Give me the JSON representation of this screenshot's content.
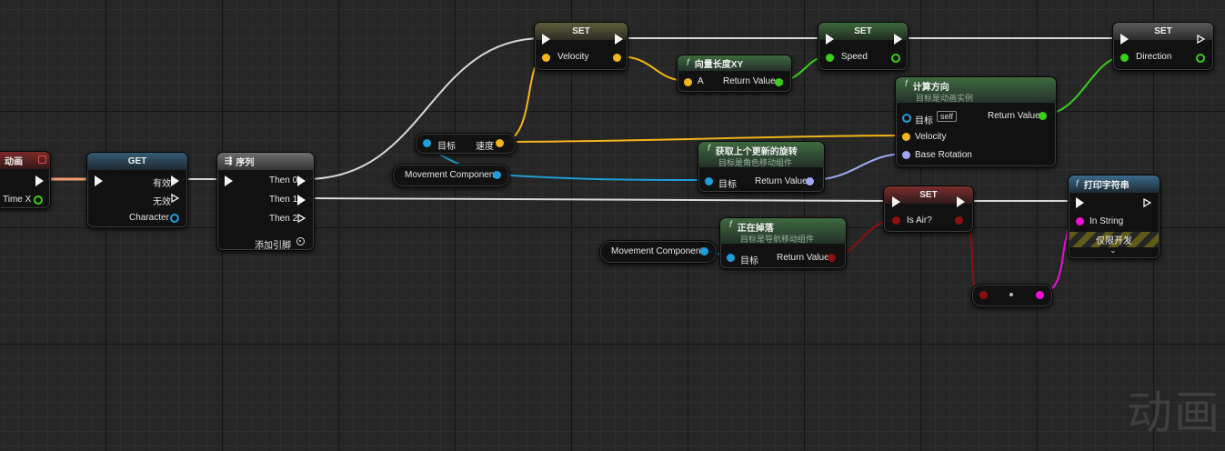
{
  "colors": {
    "exec": "#f2f2f2",
    "vector": "#f2b61c",
    "object": "#1f9ed8",
    "boolean": "#8d0f0f",
    "float": "#39d01a",
    "rotator": "#9fa8f2",
    "string": "#f10fd8",
    "orange": "#f0a070"
  },
  "nodes": {
    "anim_event": {
      "title": "动画",
      "pin": "Time X"
    },
    "get_node": {
      "title": "GET",
      "pin_valid": "有效",
      "pin_invalid": "无效",
      "pin_character": "Character"
    },
    "sequence": {
      "title": "序列",
      "then0": "Then 0",
      "then1": "Then 1",
      "then2": "Then 2",
      "add_pin": "添加引脚"
    },
    "set_velocity": {
      "title": "SET",
      "pin": "Velocity"
    },
    "set_speed": {
      "title": "SET",
      "pin": "Speed"
    },
    "set_direction": {
      "title": "SET",
      "pin": "Direction"
    },
    "vector_length": {
      "title": "向量长度XY",
      "pin_a": "A",
      "return": "Return Value"
    },
    "calc_direction": {
      "title": "计算方向",
      "subtitle": "目标是动画实例",
      "target": "目标",
      "self": "self",
      "return": "Return Value",
      "velocity": "Velocity",
      "base_rotation": "Base Rotation"
    },
    "get_last_rotation": {
      "title": "获取上个更新的旋转",
      "subtitle": "目标是角色移动组件",
      "target": "目标",
      "return": "Return Value"
    },
    "velocity_get": {
      "target": "目标",
      "speed": "速度"
    },
    "movement_component_1": {
      "label": "Movement Component"
    },
    "movement_component_2": {
      "label": "Movement Component"
    },
    "is_falling": {
      "title": "正在掉落",
      "subtitle": "目标是导航移动组件",
      "target": "目标",
      "return": "Return Value"
    },
    "set_is_air": {
      "title": "SET",
      "pin": "Is Air?"
    },
    "print_string": {
      "title": "打印字符串",
      "pin": "In String",
      "dev_only": "仅限开发"
    }
  },
  "watermark": "动画"
}
